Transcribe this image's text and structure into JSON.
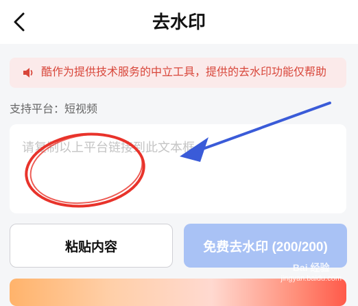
{
  "header": {
    "title": "去水印",
    "back_icon": "chevron-left-icon"
  },
  "notice": {
    "icon": "speaker-icon",
    "text": "酷作为提供技术服务的中立工具，提供的去水印功能仅帮助",
    "color": "#d8463a",
    "background": "#fbeaea"
  },
  "platform_label": "支持平台：短视频",
  "input": {
    "placeholder": "请复制以上平台链接到此文本框"
  },
  "buttons": {
    "paste_label": "粘贴内容",
    "remove_watermark_label": "免费去水印 (200/200)",
    "remove_watermark_color": "#a9c2f5"
  },
  "watermark": {
    "line1": "Bai 经验",
    "line2": "jingyan.baidu.com"
  }
}
